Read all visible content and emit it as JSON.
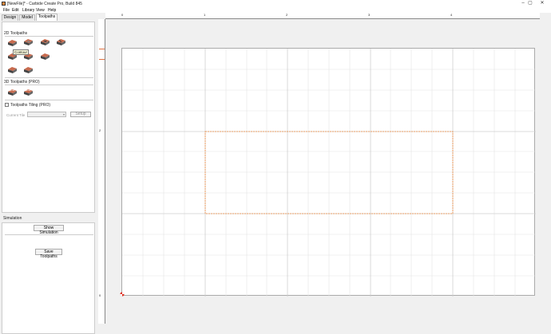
{
  "window": {
    "title": "[NewFile]* - Carbide Create Pro, Build 845",
    "minimize": "–",
    "maximize": "▢",
    "close": "✕"
  },
  "menu": [
    "File",
    "Edit",
    "Library",
    "View",
    "Help"
  ],
  "tabs": [
    "Design",
    "Model",
    "Toolpaths"
  ],
  "active_tab": "Toolpaths",
  "toolpaths_2d": {
    "heading": "2D Toolpaths",
    "tooltip": "Contour",
    "tools": [
      "contour-toolpath-icon",
      "pocket-toolpath-icon",
      "drill-toolpath-icon",
      "vcarve-toolpath-icon",
      "texture-toolpath-icon",
      "advanced-vcarve-icon",
      "chamfer-toolpath-icon",
      "rough-toolpath-icon",
      "finish-toolpath-icon"
    ]
  },
  "toolpaths_3d": {
    "heading": "3D Toolpaths (PRO)",
    "tools": [
      "3d-rough-icon",
      "3d-finish-icon"
    ]
  },
  "tiling": {
    "label": "Toolpaths Tiling (PRO)",
    "checked": false,
    "current_tile_label": "Current Tile",
    "setup_label": "Setup"
  },
  "simulation": {
    "heading": "Simulation",
    "show_button": "Show Simulation",
    "save_button": "Save Toolpaths"
  },
  "ruler": {
    "top_labels": [
      "0",
      "1",
      "2",
      "3",
      "4"
    ],
    "left_labels": [
      "2",
      "1",
      "0"
    ]
  },
  "colors": {
    "accent": "#f08a3c",
    "icon_top": "#c86b4e",
    "icon_body": "#5a5a5a"
  }
}
